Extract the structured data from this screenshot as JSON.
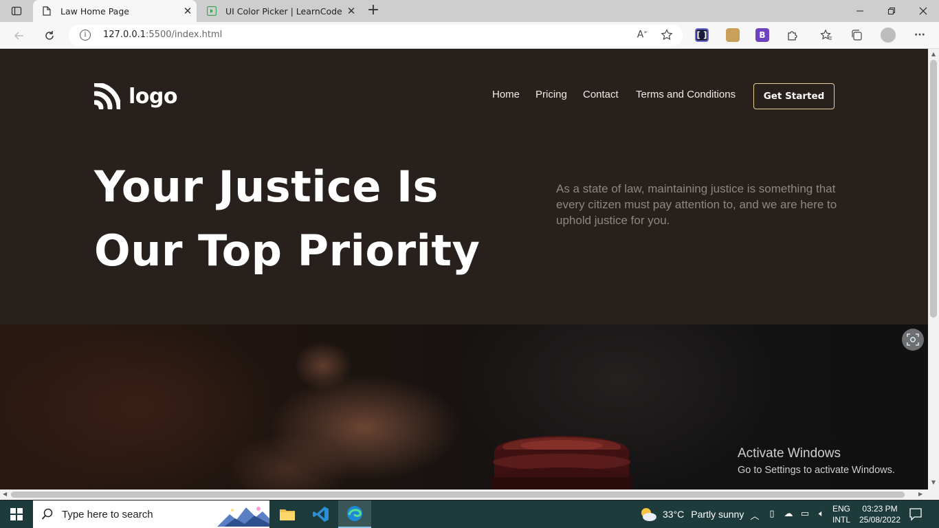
{
  "browser": {
    "tabs": [
      {
        "title": "Law Home Page",
        "active": true
      },
      {
        "title": "UI Color Picker | LearnCodeOnline",
        "active": false
      }
    ],
    "address": {
      "host": "127.0.0.1",
      "path": ":5500/index.html"
    }
  },
  "site": {
    "logo_text": "logo",
    "nav": [
      "Home",
      "Pricing",
      "Contact",
      "Terms and Conditions"
    ],
    "cta_label": "Get Started",
    "headline_line1": "Your Justice Is",
    "headline_line2": "Our Top Priority",
    "subcopy": "As a state of law, maintaining justice is something that every citizen must pay attention to, and we are here to uphold justice for you.",
    "colors": {
      "hero_bg": "#28201c",
      "cta_border": "#e7cf98",
      "subcopy": "#8f8681"
    }
  },
  "watermark": {
    "title": "Activate Windows",
    "subtitle": "Go to Settings to activate Windows."
  },
  "taskbar": {
    "search_placeholder": "Type here to search",
    "weather_temp": "33°C",
    "weather_text": "Partly sunny",
    "lang_line1": "ENG",
    "lang_line2": "INTL",
    "time": "03:23 PM",
    "date": "25/08/2022"
  }
}
